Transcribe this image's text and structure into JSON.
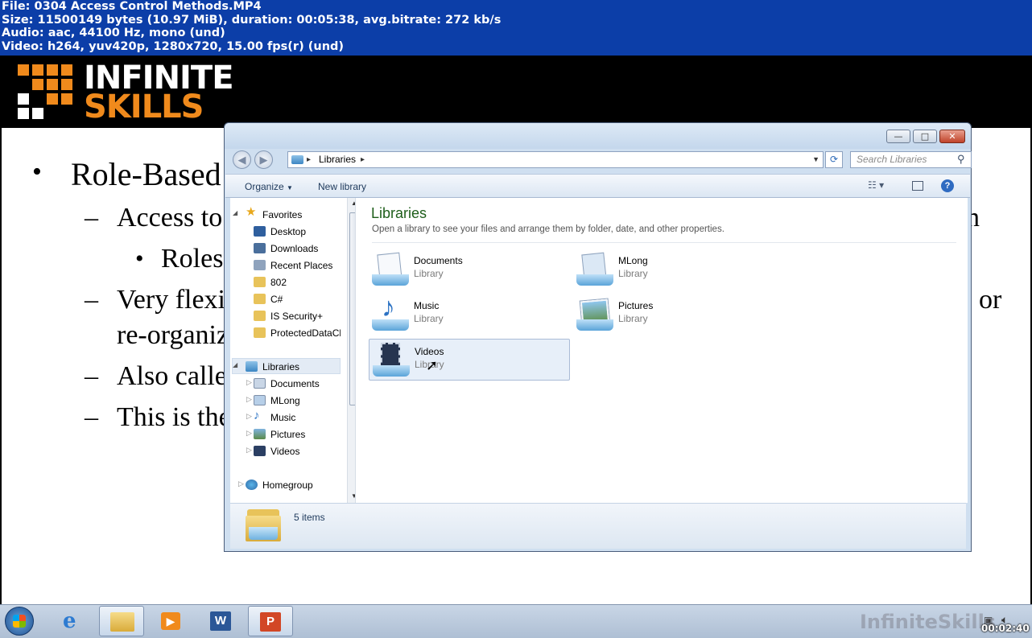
{
  "meta": {
    "line1": "File: 0304 Access Control Methods.MP4",
    "line2": "Size: 11500149 bytes (10.97 MiB), duration: 00:05:38, avg.bitrate: 272 kb/s",
    "line3": "Audio: aac, 44100 Hz, mono (und)",
    "line4": "Video: h264, yuv420p, 1280x720, 15.00 fps(r) (und)"
  },
  "logo": {
    "line1": "INFINITE",
    "line2": "SKILLS"
  },
  "slide": {
    "bullet1": "Role-Based",
    "sub1": "Access to",
    "subsub1": "Roles",
    "sub2": "Very flexi",
    "sub2_right": "or",
    "sub2_cont": "re-organiz",
    "sub3": "Also calle",
    "sub4": "This is the",
    "right_edge": "n",
    "bullet_char": "•",
    "dash_char": "–"
  },
  "window": {
    "caption_buttons": {
      "minimize": "—",
      "maximize": "□",
      "close": "✕"
    },
    "address": {
      "path": "Libraries",
      "sep": "▸"
    },
    "search_placeholder": "Search Libraries",
    "commands": {
      "organize": "Organize",
      "new_library": "New library"
    },
    "nav": {
      "favorites": "Favorites",
      "favorites_items": [
        "Desktop",
        "Downloads",
        "Recent Places",
        "802",
        "C#",
        "IS Security+",
        "ProtectedDataCl"
      ],
      "libraries": "Libraries",
      "library_items": [
        "Documents",
        "MLong",
        "Music",
        "Pictures",
        "Videos"
      ],
      "homegroup": "Homegroup"
    },
    "content": {
      "title": "Libraries",
      "subtitle": "Open a library to see your files and arrange them by folder, date, and other properties.",
      "libraries": [
        {
          "name": "Documents",
          "type": "Library"
        },
        {
          "name": "MLong",
          "type": "Library"
        },
        {
          "name": "Music",
          "type": "Library"
        },
        {
          "name": "Pictures",
          "type": "Library"
        },
        {
          "name": "Videos",
          "type": "Library"
        }
      ]
    },
    "details": {
      "count": "5 items"
    }
  },
  "taskbar": {
    "watermark": "InfiniteSkills",
    "clock": "00:02:40"
  },
  "colors": {
    "title_bar": "#0c3ea8",
    "logo_orange": "#f08a1c",
    "content_title": "#1e5e1a"
  }
}
